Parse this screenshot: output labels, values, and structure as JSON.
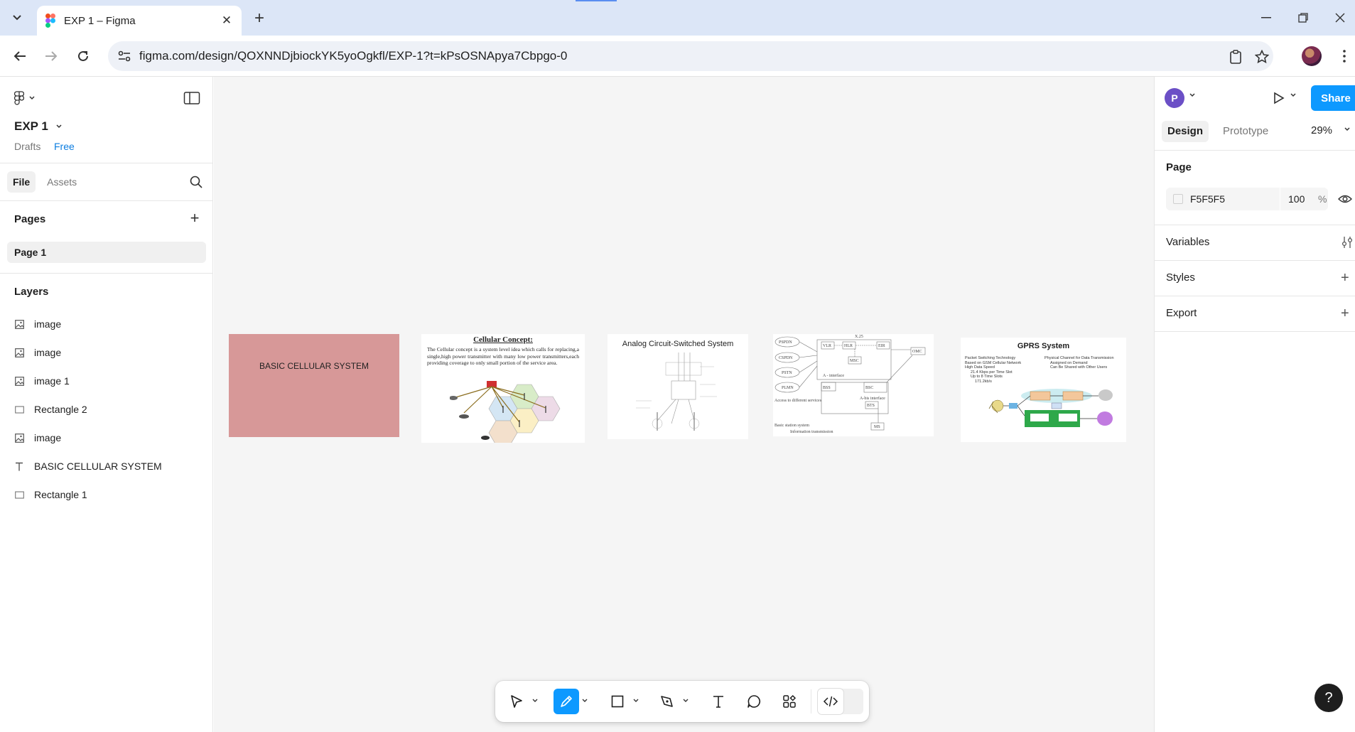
{
  "browser": {
    "tab_title": "EXP 1 – Figma",
    "url": "figma.com/design/QOXNNDjbiockYK5yoOgkfl/EXP-1?t=kPsOSNApya7Cbpgo-0"
  },
  "left_panel": {
    "file_name": "EXP 1",
    "drafts_label": "Drafts",
    "plan_label": "Free",
    "tabs": [
      "File",
      "Assets"
    ],
    "pages_title": "Pages",
    "pages": [
      "Page 1"
    ],
    "layers_title": "Layers",
    "layers": [
      {
        "icon": "image-icon",
        "label": "image"
      },
      {
        "icon": "image-icon",
        "label": "image"
      },
      {
        "icon": "image-icon",
        "label": "image 1"
      },
      {
        "icon": "rectangle-icon",
        "label": "Rectangle 2"
      },
      {
        "icon": "image-icon",
        "label": "image"
      },
      {
        "icon": "text-icon",
        "label": "BASIC CELLULAR SYSTEM"
      },
      {
        "icon": "rectangle-icon",
        "label": "Rectangle 1"
      }
    ]
  },
  "canvas": {
    "rect_text": "BASIC CELLULAR SYSTEM",
    "rect_color": "#D79898",
    "slide_cellular": {
      "title": "Cellular Concept:",
      "body": "The Cellular concept is a system level idea which calls for replacing,a single,high power transmitter with many low power transmitters,each providing coverage to only small portion of the service area."
    },
    "slide_analog": {
      "title": "Analog Circuit-Switched System"
    },
    "slide_gsm": {
      "labels": [
        "PSPDN",
        "CSPDN",
        "PSTN",
        "PLMN",
        "VLR",
        "HLR",
        "EIR",
        "OMC",
        "MSC",
        "BSS",
        "BSC",
        "BTS",
        "MS",
        "X.25",
        "A - interface",
        "A-bis interface",
        "Access to different services",
        "Basic station system",
        "Information transmission"
      ]
    },
    "slide_gprs": {
      "title": "GPRS System",
      "bullets_left": [
        "Packet Switching Technology",
        "Based on GSM Cellular Network",
        "High Data Speed",
        "21.4 Kbps per Time Slot",
        "Up to 8 Time Slots",
        "171.2kb/s"
      ],
      "bullets_right": [
        "Physical Channel for Data Transmission",
        "Assigned on Demand",
        "Can Be Shared with Other Users"
      ]
    }
  },
  "right_panel": {
    "avatar_initial": "P",
    "share_label": "Share",
    "tabs": [
      "Design",
      "Prototype"
    ],
    "zoom": "29%",
    "page_section": "Page",
    "page_color_hex": "F5F5F5",
    "page_opacity": "100",
    "percent_sign": "%",
    "sections": [
      "Variables",
      "Styles",
      "Export"
    ]
  },
  "help_label": "?",
  "colors": {
    "accent": "#0D99FF",
    "canvas_bg": "#F5F5F5",
    "tabstrip_bg": "#DCE6F7"
  }
}
